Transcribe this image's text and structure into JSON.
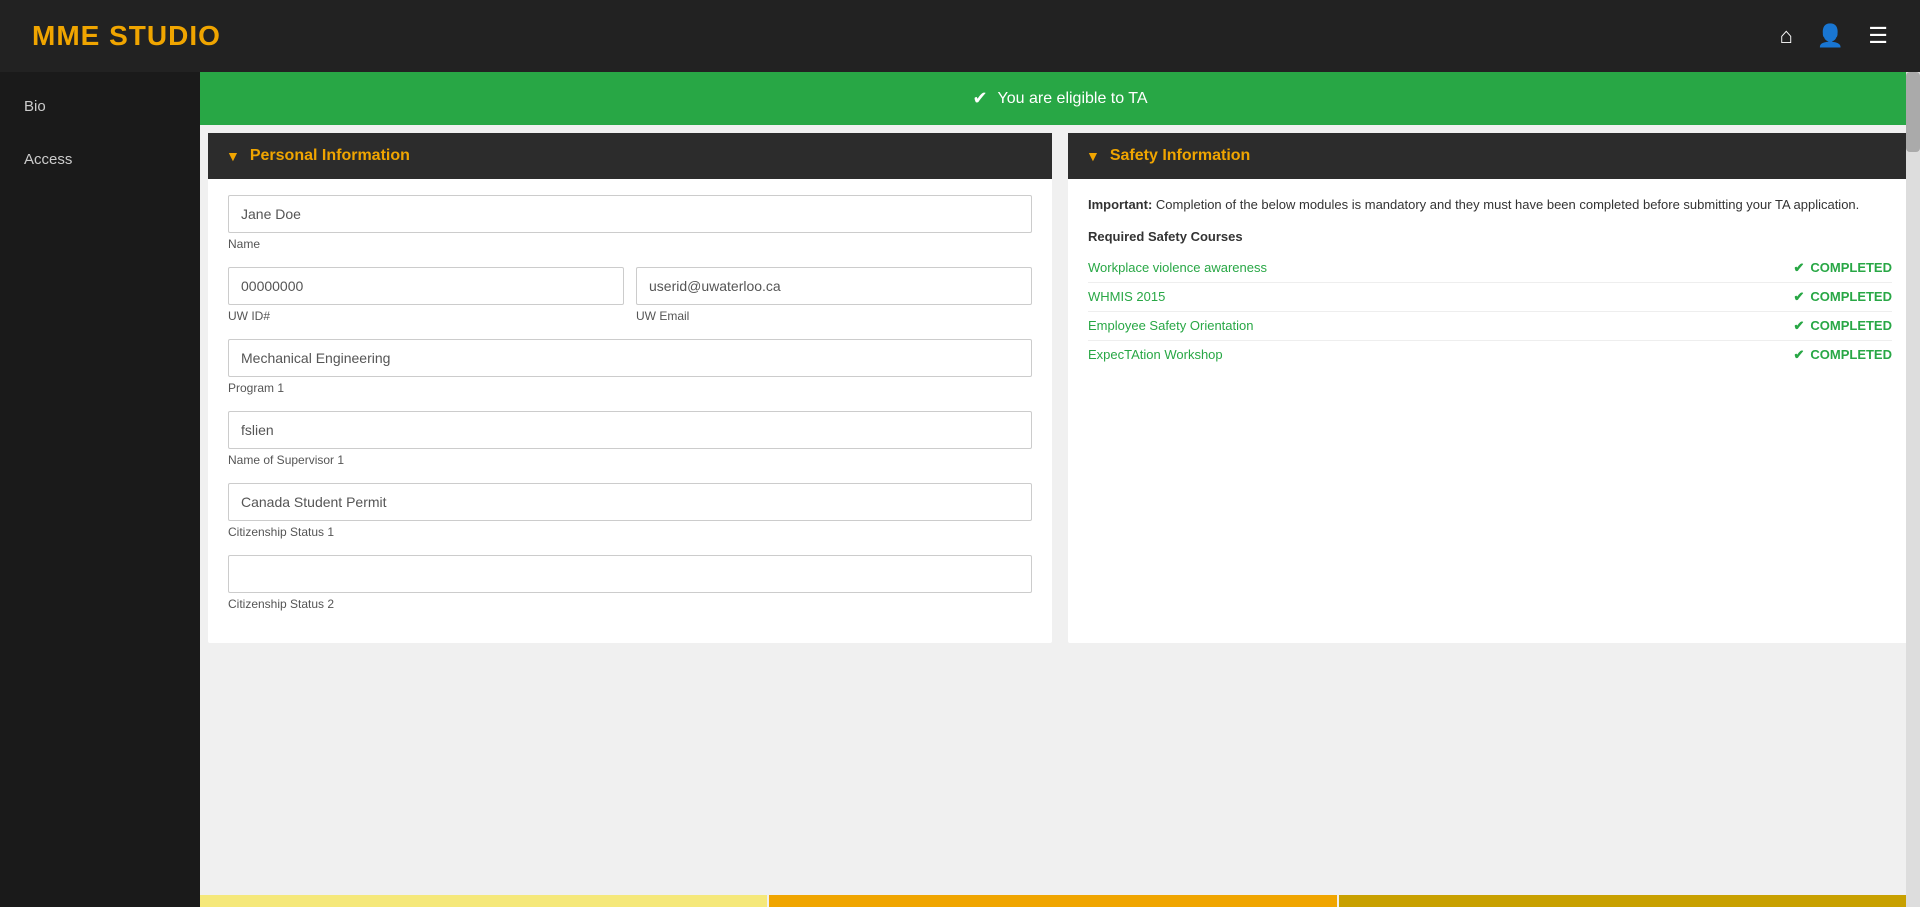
{
  "header": {
    "title": "MME STUDIO",
    "home_icon": "⌂",
    "user_icon": "👤",
    "menu_icon": "☰"
  },
  "sidebar": {
    "items": [
      {
        "label": "Bio"
      },
      {
        "label": "Access"
      }
    ]
  },
  "eligibility_banner": {
    "text": "You are eligible to TA",
    "check": "✔"
  },
  "personal_info": {
    "section_title": "Personal Information",
    "name": {
      "value": "Jane Doe",
      "label": "Name"
    },
    "uw_id": {
      "value": "00000000",
      "label": "UW ID#"
    },
    "uw_email": {
      "value": "userid@uwaterloo.ca",
      "label": "UW Email"
    },
    "program1": {
      "value": "Mechanical Engineering",
      "label": "Program 1"
    },
    "supervisor1": {
      "value": "fslien",
      "label": "Name of Supervisor 1"
    },
    "citizenship1": {
      "value": "Canada Student Permit",
      "label": "Citizenship Status 1"
    },
    "citizenship2": {
      "value": "",
      "label": "Citizenship Status 2"
    }
  },
  "safety_info": {
    "section_title": "Safety Information",
    "description": "Completion of the below modules is mandatory and they must have been completed before submitting your TA application.",
    "courses_title": "Required Safety Courses",
    "courses": [
      {
        "name": "Workplace violence awareness",
        "status": "COMPLETED"
      },
      {
        "name": "WHMIS 2015",
        "status": "COMPLETED"
      },
      {
        "name": "Employee Safety Orientation",
        "status": "COMPLETED"
      },
      {
        "name": "ExpecTAtion Workshop",
        "status": "COMPLETED"
      }
    ]
  }
}
